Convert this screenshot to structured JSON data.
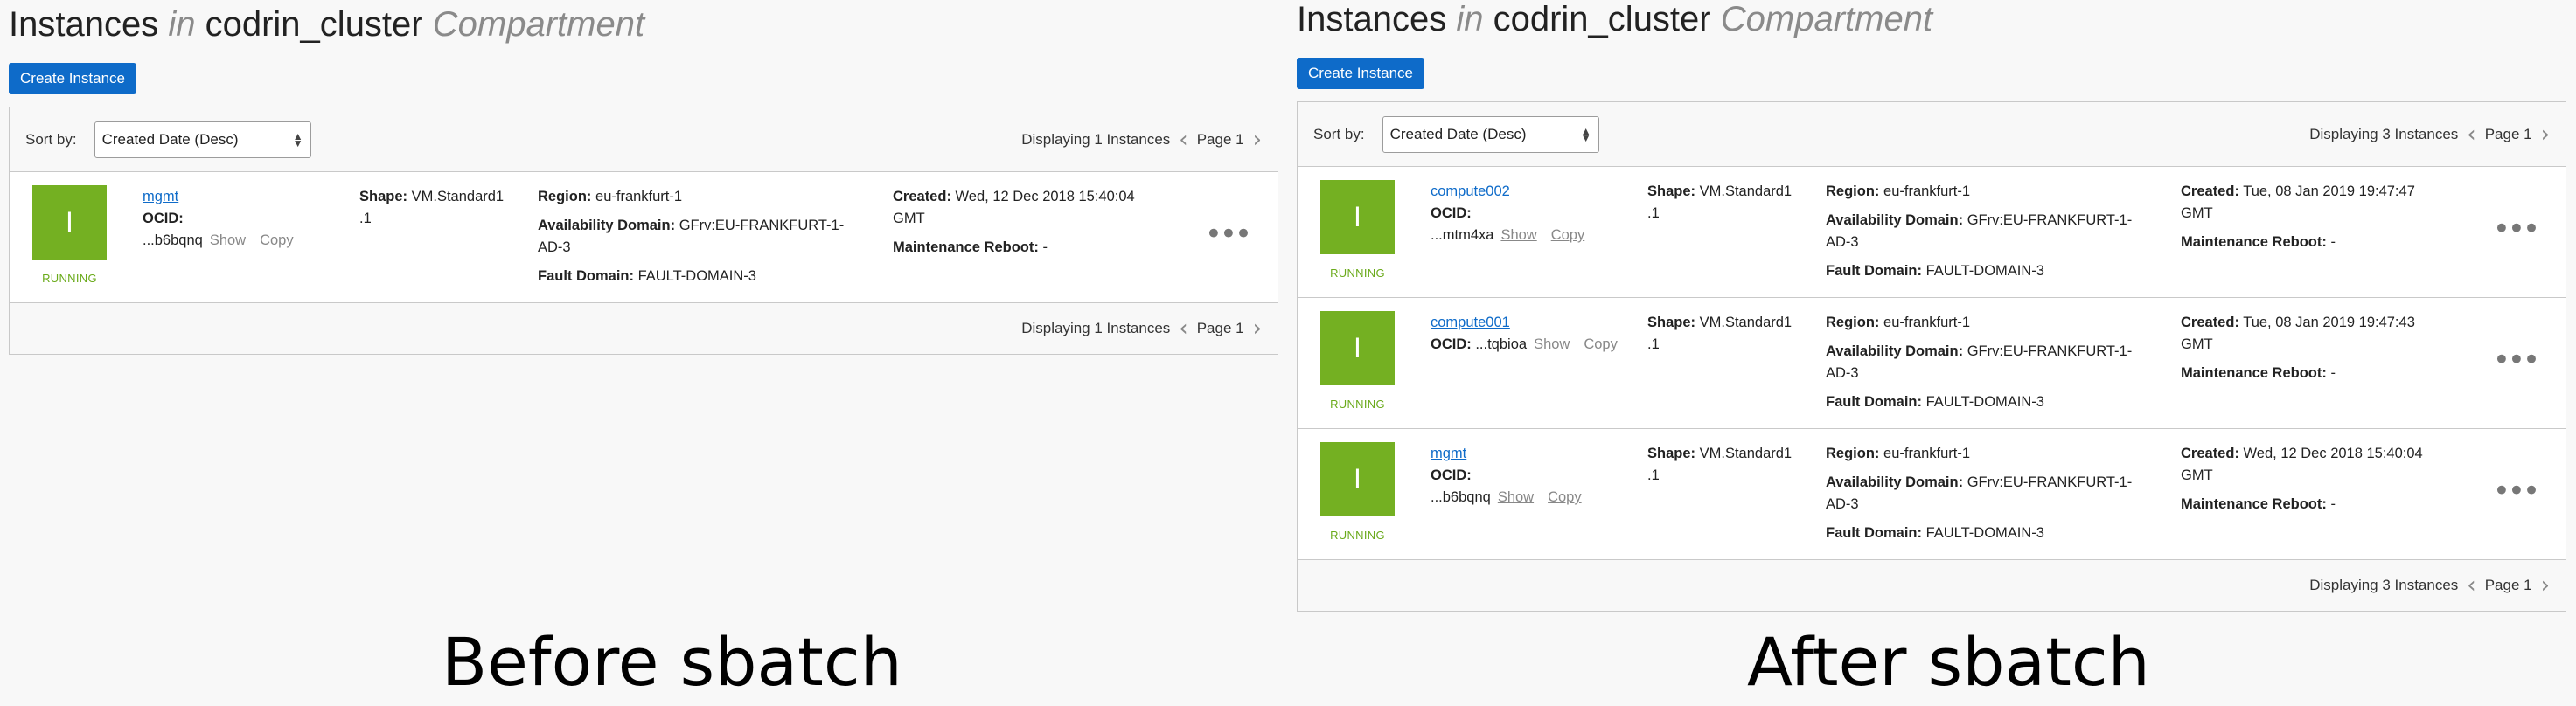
{
  "panels": {
    "before": {
      "title": {
        "main": "Instances",
        "in": "in",
        "compartment": "codrin_cluster",
        "suffix": "Compartment"
      },
      "create_button": "Create Instance",
      "sort_label": "Sort by:",
      "sort_value": "Created Date (Desc)",
      "displaying": "Displaying 1 Instances",
      "page": "Page 1",
      "instances": [
        {
          "icon_letter": "I",
          "state": "RUNNING",
          "name": "mgmt",
          "ocid_label": "OCID:",
          "ocid_value": "...b6bqnq",
          "show": "Show",
          "copy": "Copy",
          "shape_label": "Shape:",
          "shape_a": "VM.Standard1",
          "shape_b": ".1",
          "region_label": "Region:",
          "region": "eu-frankfurt-1",
          "ad_label": "Availability Domain:",
          "ad_a": "GFrv:EU-FRANKFURT-1-",
          "ad_b": "AD-3",
          "fd_label": "Fault Domain:",
          "fd": "FAULT-DOMAIN-3",
          "created_label": "Created:",
          "created_a": "Wed, 12 Dec 2018 15:40:04",
          "created_b": "GMT",
          "mr_label": "Maintenance Reboot:",
          "mr": "-",
          "menu": "•••"
        }
      ]
    },
    "after": {
      "title": {
        "main": "Instances",
        "in": "in",
        "compartment": "codrin_cluster",
        "suffix": "Compartment"
      },
      "create_button": "Create Instance",
      "sort_label": "Sort by:",
      "sort_value": "Created Date (Desc)",
      "displaying": "Displaying 3 Instances",
      "page": "Page 1",
      "instances": [
        {
          "icon_letter": "I",
          "state": "RUNNING",
          "name": "compute002",
          "ocid_label": "OCID:",
          "ocid_value": "...mtm4xa",
          "show": "Show",
          "copy": "Copy",
          "shape_label": "Shape:",
          "shape_a": "VM.Standard1",
          "shape_b": ".1",
          "region_label": "Region:",
          "region": "eu-frankfurt-1",
          "ad_label": "Availability Domain:",
          "ad_a": "GFrv:EU-FRANKFURT-1-",
          "ad_b": "AD-3",
          "fd_label": "Fault Domain:",
          "fd": "FAULT-DOMAIN-3",
          "created_label": "Created:",
          "created_a": "Tue, 08 Jan 2019 19:47:47",
          "created_b": "GMT",
          "mr_label": "Maintenance Reboot:",
          "mr": "-",
          "menu": "•••"
        },
        {
          "icon_letter": "I",
          "state": "RUNNING",
          "name": "compute001",
          "ocid_label": "OCID:",
          "ocid_value": "...tqbioa",
          "show": "Show",
          "copy": "Copy",
          "shape_label": "Shape:",
          "shape_a": "VM.Standard1",
          "shape_b": ".1",
          "region_label": "Region:",
          "region": "eu-frankfurt-1",
          "ad_label": "Availability Domain:",
          "ad_a": "GFrv:EU-FRANKFURT-1-",
          "ad_b": "AD-3",
          "fd_label": "Fault Domain:",
          "fd": "FAULT-DOMAIN-3",
          "created_label": "Created:",
          "created_a": "Tue, 08 Jan 2019 19:47:43",
          "created_b": "GMT",
          "mr_label": "Maintenance Reboot:",
          "mr": "-",
          "menu": "•••"
        },
        {
          "icon_letter": "I",
          "state": "RUNNING",
          "name": "mgmt",
          "ocid_label": "OCID:",
          "ocid_value": "...b6bqnq",
          "show": "Show",
          "copy": "Copy",
          "shape_label": "Shape:",
          "shape_a": "VM.Standard1",
          "shape_b": ".1",
          "region_label": "Region:",
          "region": "eu-frankfurt-1",
          "ad_label": "Availability Domain:",
          "ad_a": "GFrv:EU-FRANKFURT-1-",
          "ad_b": "AD-3",
          "fd_label": "Fault Domain:",
          "fd": "FAULT-DOMAIN-3",
          "created_label": "Created:",
          "created_a": "Wed, 12 Dec 2018 15:40:04",
          "created_b": "GMT",
          "mr_label": "Maintenance Reboot:",
          "mr": "-",
          "menu": "•••"
        }
      ]
    }
  },
  "captions": {
    "before": "Before sbatch",
    "after": "After sbatch"
  },
  "colors": {
    "primary_button": "#0e6bc9",
    "instance_icon": "#74b022",
    "running_state": "#6aaa1a"
  }
}
